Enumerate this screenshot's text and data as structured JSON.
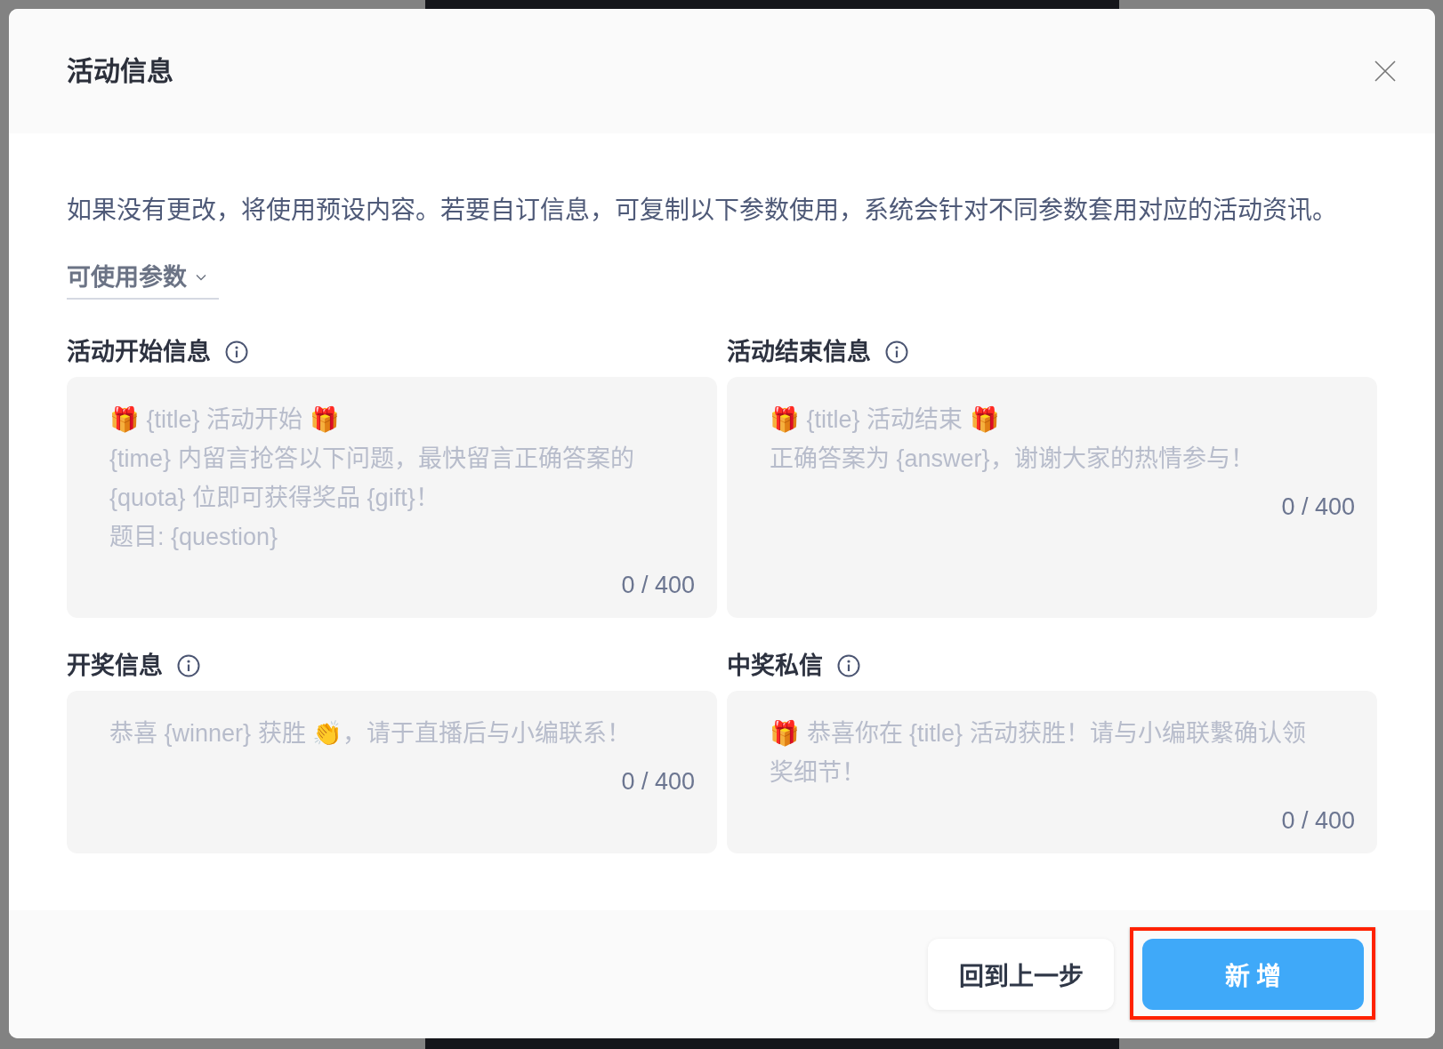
{
  "dialog": {
    "title": "活动信息",
    "intro": "如果没有更改，将使用预设内容。若要自订信息，可复制以下参数使用，系统会针对不同参数套用对应的活动资讯。",
    "parameters_toggle": {
      "label": "可使用参数",
      "expanded": false
    },
    "fields": [
      {
        "label": "活动开始信息",
        "placeholder": [
          "🎁 {title} 活动开始 🎁",
          "{time} 内留言抢答以下问题，最快留言正确答案的 {quota} 位即可获得奖品 {gift}！",
          "题目: {question}"
        ],
        "counter": "0 / 400"
      },
      {
        "label": "活动结束信息",
        "placeholder": [
          "🎁 {title} 活动结束 🎁",
          "正确答案为 {answer}，谢谢大家的热情参与！"
        ],
        "counter": "0 / 400"
      },
      {
        "label": "开奖信息",
        "placeholder": [
          "恭喜 {winner} 获胜 👏，请于直播后与小编联系！"
        ],
        "counter": "0 / 400"
      },
      {
        "label": "中奖私信",
        "placeholder": [
          "🎁 恭喜你在 {title} 活动获胜！请与小编联繫确认领奖细节！"
        ],
        "counter": "0 / 400"
      }
    ],
    "buttons": [
      {
        "label": "回到上一步",
        "kind": "secondary",
        "highlighted": false
      },
      {
        "label": "新 增",
        "kind": "primary",
        "highlighted": true
      }
    ]
  }
}
